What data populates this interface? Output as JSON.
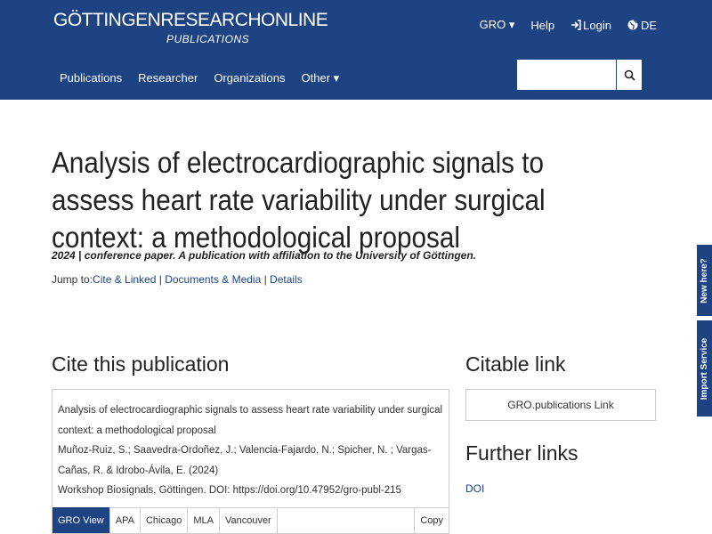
{
  "header": {
    "logo_main": "GÖTTINGENRESEARCHONLINE",
    "logo_sub": "PUBLICATIONS",
    "top_nav": {
      "gro": "GRO ▾",
      "help": "Help",
      "login": "Login",
      "lang": "DE"
    },
    "main_nav": [
      "Publications",
      "Researcher",
      "Organizations",
      "Other ▾"
    ],
    "search_placeholder": ""
  },
  "publication": {
    "title": "Analysis of electrocardiographic signals to assess heart rate variability under surgical context: a methodological proposal",
    "meta": "2024 | conference paper. A publication with affiliation to the University of Göttingen.",
    "jump_label": "Jump to:",
    "jump_links": [
      "Cite & Linked",
      "Documents & Media",
      "Details"
    ]
  },
  "cite": {
    "heading": "Cite this publication",
    "lines": [
      "Analysis of electrocardiographic signals to assess heart rate variability under surgical context: a methodological proposal",
      "Muñoz-Ruiz, S.; Saavedra-Ordoñez, J.; Valencia-Fajardo, N.; Spicher, N. ; Vargas- Cañas, R. & Idrobo-Ávila, E. (2024)",
      "Workshop Biosignals, Göttingen. DOI: https://doi.org/10.47952/gro-publ-215"
    ],
    "tabs": [
      "GRO View",
      "APA",
      "Chicago",
      "MLA",
      "Vancouver"
    ],
    "copy_label": "Copy"
  },
  "citable": {
    "heading": "Citable link",
    "button": "GRO.publications Link"
  },
  "further": {
    "heading": "Further links",
    "doi": "DOI"
  },
  "side": {
    "new_here": "New here?",
    "import": "Import Service"
  },
  "colors": {
    "brand": "#1e4383"
  }
}
